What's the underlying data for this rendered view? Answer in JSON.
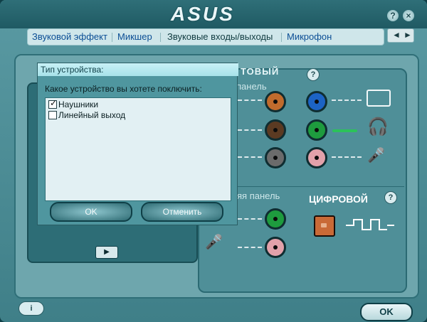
{
  "header": {
    "logo_text": "ASUS",
    "help_glyph": "?",
    "close_glyph": "×"
  },
  "tabs": [
    {
      "label": "Звуковой эффект"
    },
    {
      "label": "Микшер"
    },
    {
      "label": "Звуковые входы/выходы",
      "active": true
    },
    {
      "label": "Микрофон"
    }
  ],
  "nav": {
    "prev_glyph": "◄",
    "next_glyph": "►"
  },
  "io": {
    "analog_title": "ТОВЫЙ",
    "front_subtitle": "панель",
    "rear_subtitle": "яя панель",
    "digital_title": "ЦИФРОВОЙ",
    "help_glyph": "?",
    "colors": {
      "orange": "#c06b2d",
      "brown": "#5b3a22",
      "gray": "#6b6b6b",
      "blue": "#1c63c4",
      "green": "#1e9b3e",
      "pink": "#e2a1aa"
    }
  },
  "play": {
    "glyph": "▶"
  },
  "dialog": {
    "title": "Тип устройства:",
    "question": "Какое устройство вы хотете поключить:",
    "options": [
      {
        "label": "Наушники",
        "checked": true
      },
      {
        "label": "Линейный выход",
        "checked": false
      }
    ],
    "ok_label": "OK",
    "cancel_label": "Отменить"
  },
  "footer": {
    "ok_label": "OK",
    "info_glyph": "i"
  }
}
